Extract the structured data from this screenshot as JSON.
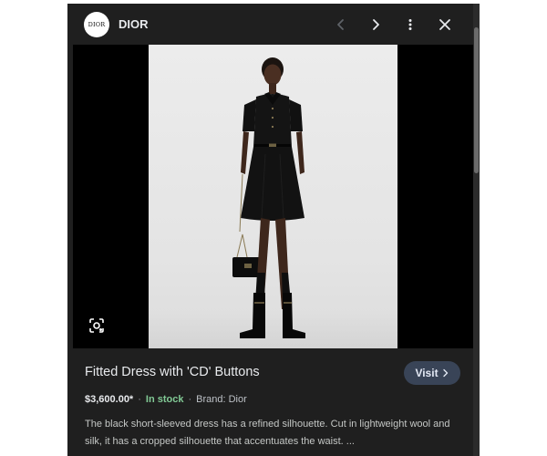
{
  "header": {
    "brand_logo_text": "DIOR",
    "brand_name": "DIOR",
    "icons": [
      "chevron-left-icon",
      "chevron-right-icon",
      "more-vert-icon",
      "close-icon"
    ]
  },
  "image": {
    "alt": "Fitted Dress with 'CD' Buttons",
    "lens_icon": "lens-search-icon"
  },
  "product": {
    "title": "Fitted Dress with 'CD' Buttons",
    "visit_label": "Visit",
    "price": "$3,600.00*",
    "availability": "In stock",
    "brand": "Brand: Dior",
    "description": "The black short-sleeved dress has a refined silhouette. Cut in lightweight wool and silk, it has a cropped silhouette that accentuates the waist. ..."
  },
  "colors": {
    "panel_bg": "#1f1f1f",
    "image_bg": "#000000",
    "visit_button_bg": "#394457",
    "in_stock": "#81c995"
  }
}
